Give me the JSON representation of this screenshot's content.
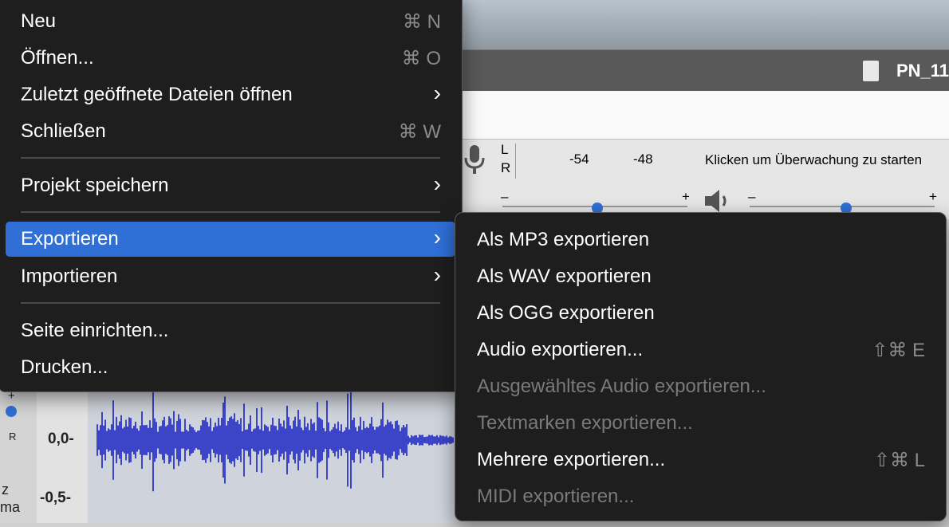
{
  "background": {
    "window_title": "PN_11",
    "meter": {
      "channels": [
        "L",
        "R"
      ],
      "ticks": [
        "-54",
        "-48"
      ],
      "message": "Klicken um Überwachung zu starten"
    },
    "sliders": {
      "minus": "–",
      "plus": "+"
    },
    "track": {
      "scale_top": "0,0-",
      "scale_bottom": "-0,5-",
      "side_letter": "R",
      "side_label_1": "z",
      "side_label_2": "ma",
      "plus_label": "+"
    }
  },
  "file_menu": {
    "items": [
      {
        "label": "Neu",
        "shortcut": "⌘ N"
      },
      {
        "label": "Öffnen...",
        "shortcut": "⌘ O"
      },
      {
        "label": "Zuletzt geöffnete Dateien öffnen",
        "submenu": true
      },
      {
        "label": "Schließen",
        "shortcut": "⌘ W"
      },
      {
        "label": "Projekt speichern",
        "submenu": true
      },
      {
        "label": "Exportieren",
        "submenu": true,
        "active": true
      },
      {
        "label": "Importieren",
        "submenu": true
      },
      {
        "label": "Seite einrichten..."
      },
      {
        "label": "Drucken..."
      }
    ],
    "chevron": "›"
  },
  "export_submenu": {
    "items": [
      {
        "label": "Als MP3 exportieren"
      },
      {
        "label": "Als WAV exportieren"
      },
      {
        "label": "Als OGG exportieren"
      },
      {
        "label": "Audio exportieren...",
        "shortcut": "⇧⌘ E"
      },
      {
        "label": "Ausgewähltes Audio exportieren...",
        "disabled": true
      },
      {
        "label": "Textmarken exportieren...",
        "disabled": true
      },
      {
        "label": "Mehrere exportieren...",
        "shortcut": "⇧⌘ L"
      },
      {
        "label": "MIDI exportieren...",
        "disabled": true
      }
    ]
  },
  "colors": {
    "menu_bg": "#1e1e1e",
    "highlight": "#2f6fd6",
    "waveform": "#3c44c8"
  }
}
